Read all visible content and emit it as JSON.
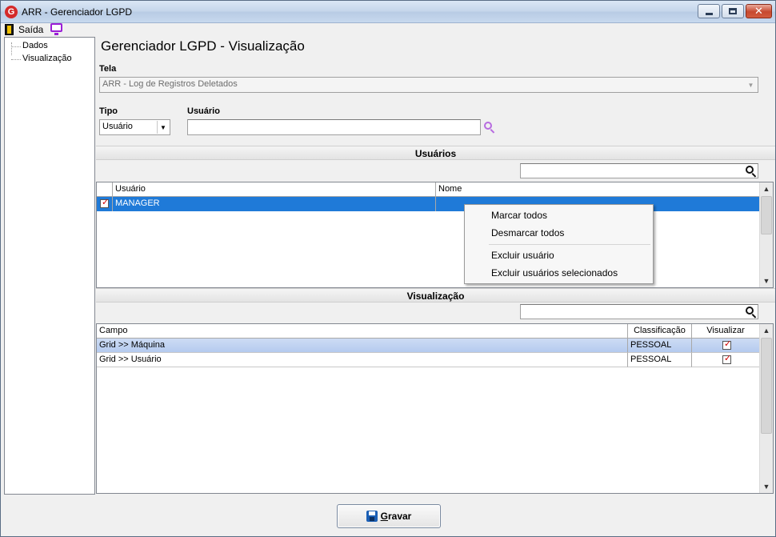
{
  "window": {
    "title": "ARR - Gerenciador LGPD",
    "logo_letter": "G"
  },
  "toolbar": {
    "exit_label": "Saída",
    "exit_icon": "exit-door-icon",
    "monitor_icon": "monitor-icon"
  },
  "tree": {
    "items": [
      {
        "label": "Dados"
      },
      {
        "label": "Visualização"
      }
    ]
  },
  "page": {
    "title": "Gerenciador LGPD - Visualização"
  },
  "tela": {
    "label": "Tela",
    "value": "ARR - Log de Registros Deletados"
  },
  "tipo": {
    "label": "Tipo",
    "value": "Usuário"
  },
  "usuario": {
    "label": "Usuário",
    "value": ""
  },
  "usuarios_section": {
    "title": "Usuários",
    "search_value": "",
    "columns": [
      "Usuário",
      "Nome"
    ],
    "rows": [
      {
        "checked": true,
        "usuario": "MANAGER",
        "nome": ""
      }
    ]
  },
  "context_menu": {
    "items": [
      "Marcar todos",
      "Desmarcar todos",
      "Excluir usuário",
      "Excluir usuários selecionados"
    ]
  },
  "visualizacao_section": {
    "title": "Visualização",
    "search_value": "",
    "columns": [
      "Campo",
      "Classificação",
      "Visualizar"
    ],
    "rows": [
      {
        "campo": "Grid >> Máquina",
        "classificacao": "PESSOAL",
        "visualizar": true
      },
      {
        "campo": "Grid >> Usuário",
        "classificacao": "PESSOAL",
        "visualizar": true
      }
    ]
  },
  "save_button": {
    "first_letter": "G",
    "rest": "ravar"
  },
  "colors": {
    "selection": "#1f7ad8",
    "search_icon_purple": "#b76be0",
    "close_red": "#c7492f"
  }
}
